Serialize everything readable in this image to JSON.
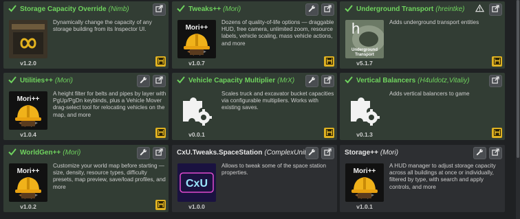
{
  "cards": [
    {
      "title": "Storage Capacity Override",
      "author": "(Nimb)",
      "description": "Dynamically change the capacity of any storage building from its Inspector UI.",
      "version": "v1.2.0",
      "enabled": true,
      "icons": [
        "external-link-icon"
      ],
      "thumb": "storage-override"
    },
    {
      "title": "Tweaks++",
      "author": "(Mori)",
      "description": "Dozens of quality-of-life options — draggable HUD, free camera, unlimited zoom, resource labels, vehicle scaling, mass vehicle actions, and more",
      "version": "v1.0.7",
      "enabled": true,
      "icons": [
        "wrench-icon",
        "external-link-icon"
      ],
      "thumb": "mori"
    },
    {
      "title": "Underground Transport",
      "author": "(hreintke)",
      "description": "Adds underground transport entities",
      "version": "v5.1.7",
      "enabled": true,
      "icons": [
        "warning-icon",
        "external-link-icon"
      ],
      "thumb": "underground",
      "thumb_letter": "h",
      "thumb_label": "Underground Transport"
    },
    {
      "title": "Utilities++",
      "author": "(Mori)",
      "description": "A height filter for belts and pipes by layer with PgUp/PgDn keybinds, plus a Vehicle Mover drag-select tool for relocating vehicles on the map, and more",
      "version": "v1.0.4",
      "enabled": true,
      "icons": [
        "wrench-icon",
        "external-link-icon"
      ],
      "thumb": "mori"
    },
    {
      "title": "Vehicle Capacity Multiplier",
      "author": "(MrX)",
      "description": "Scales truck and excavator bucket capacities via configurable multipliers. Works with existing saves.",
      "version": "v0.0.1",
      "enabled": true,
      "icons": [
        "wrench-icon",
        "external-link-icon"
      ],
      "thumb": "puzzle"
    },
    {
      "title": "Vertical Balancers",
      "author": "(H4uldotz,Vitaliy)",
      "description": "Adds vertical balancers to game",
      "version": "v0.1.3",
      "enabled": true,
      "icons": [
        "external-link-icon"
      ],
      "thumb": "puzzle"
    },
    {
      "title": "WorldGen++",
      "author": "(Mori)",
      "description": "Customize your world map before starting — size, density, resource types, difficulty presets, map preview, save/load profiles, and more",
      "version": "v1.0.2",
      "enabled": true,
      "icons": [
        "wrench-icon",
        "external-link-icon"
      ],
      "thumb": "mori"
    },
    {
      "title": "CxU.Tweaks.SpaceStation",
      "author": "(ComplexUnit)",
      "description": "Allows to tweak some of the space station properties.",
      "version": "v1.0.0",
      "enabled": false,
      "icons": [
        "wrench-icon",
        "external-link-icon"
      ],
      "thumb": "cxu",
      "thumb_label": "CxU"
    },
    {
      "title": "Storage++",
      "author": "(Mori)",
      "description": "A HUD manager to adjust storage capacity across all buildings at once or individually, filtered by type, with search and apply controls, and more",
      "version": "v1.0.1",
      "enabled": false,
      "icons": [
        "wrench-icon",
        "external-link-icon"
      ],
      "thumb": "mori"
    }
  ],
  "mori_label": "Mori++",
  "colors": {
    "enabled_bg": "#323d34",
    "disabled_bg": "#2d2f32",
    "accent_green": "#6fd35e",
    "save_yellow": "#e0b221"
  }
}
